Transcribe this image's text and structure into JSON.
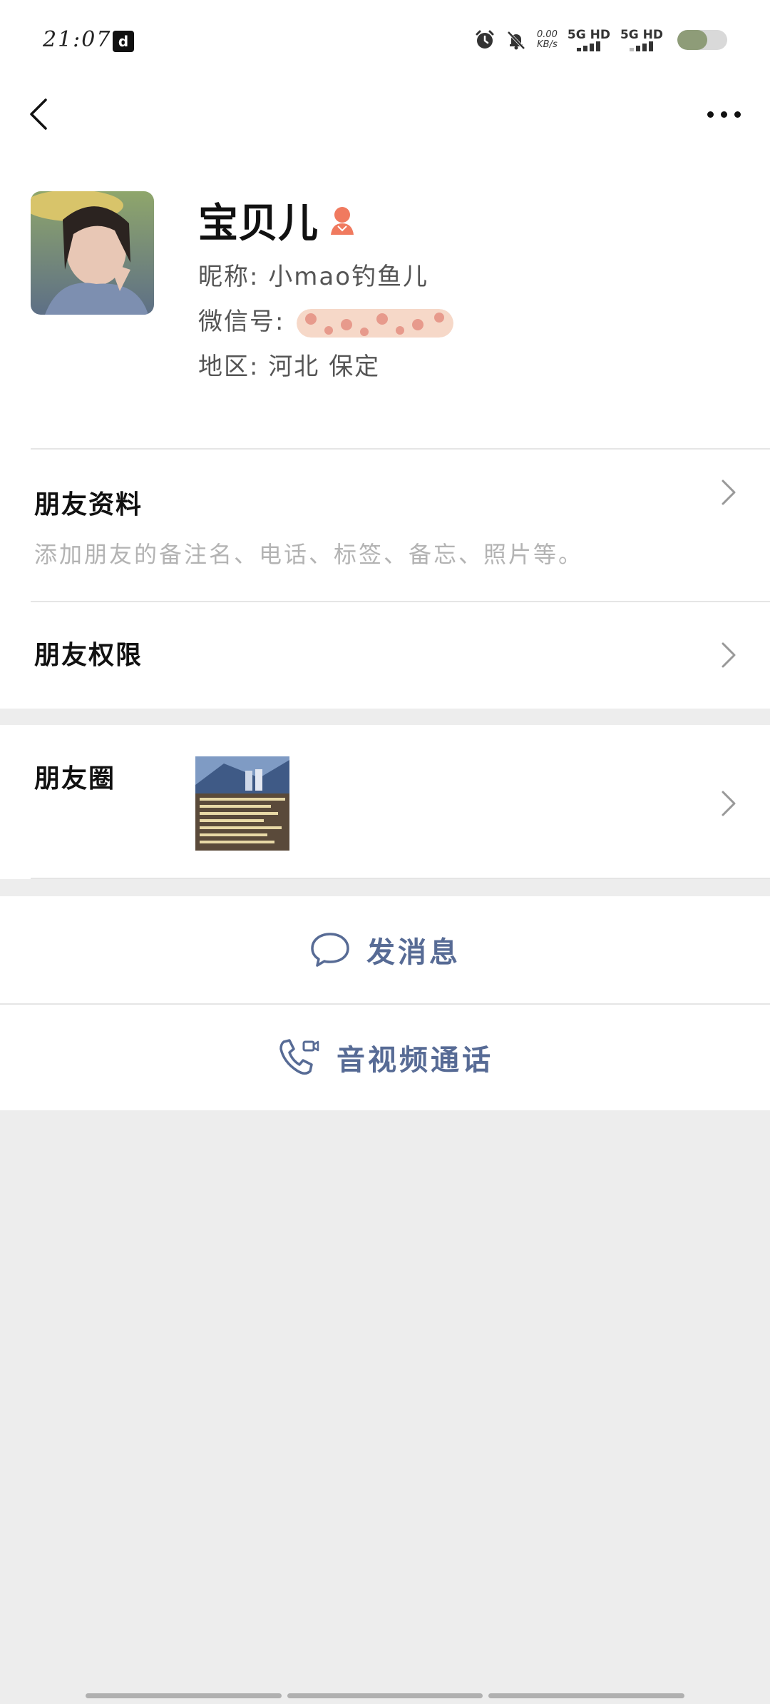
{
  "status_bar": {
    "time": "21:07",
    "app_badge": "d",
    "net_speed_value": "0.00",
    "net_speed_unit": "KB/s",
    "sim1_label": "5G HD",
    "sim2_label": "5G HD",
    "battery_level_pct": 60,
    "icons": [
      "alarm-icon",
      "mute-bell-icon",
      "signal-icon",
      "battery-icon"
    ]
  },
  "nav": {
    "back_icon": "chevron-left-icon",
    "more_icon": "more-dots-icon"
  },
  "profile": {
    "name": "宝贝儿",
    "gender_icon": "female-icon",
    "gender_color": "#f07a5f",
    "nickname_label": "昵称:",
    "nickname_value": "小mao钓鱼儿",
    "wechat_label": "微信号:",
    "region_label": "地区:",
    "region_value": "河北 保定"
  },
  "friend_info": {
    "title": "朋友资料",
    "desc": "添加朋友的备注名、电话、标签、备忘、照片等。"
  },
  "friend_permission": {
    "title": "朋友权限"
  },
  "moments": {
    "title": "朋友圈"
  },
  "actions": {
    "message_label": "发消息",
    "call_label": "音视频通话",
    "link_color": "#576b95"
  }
}
